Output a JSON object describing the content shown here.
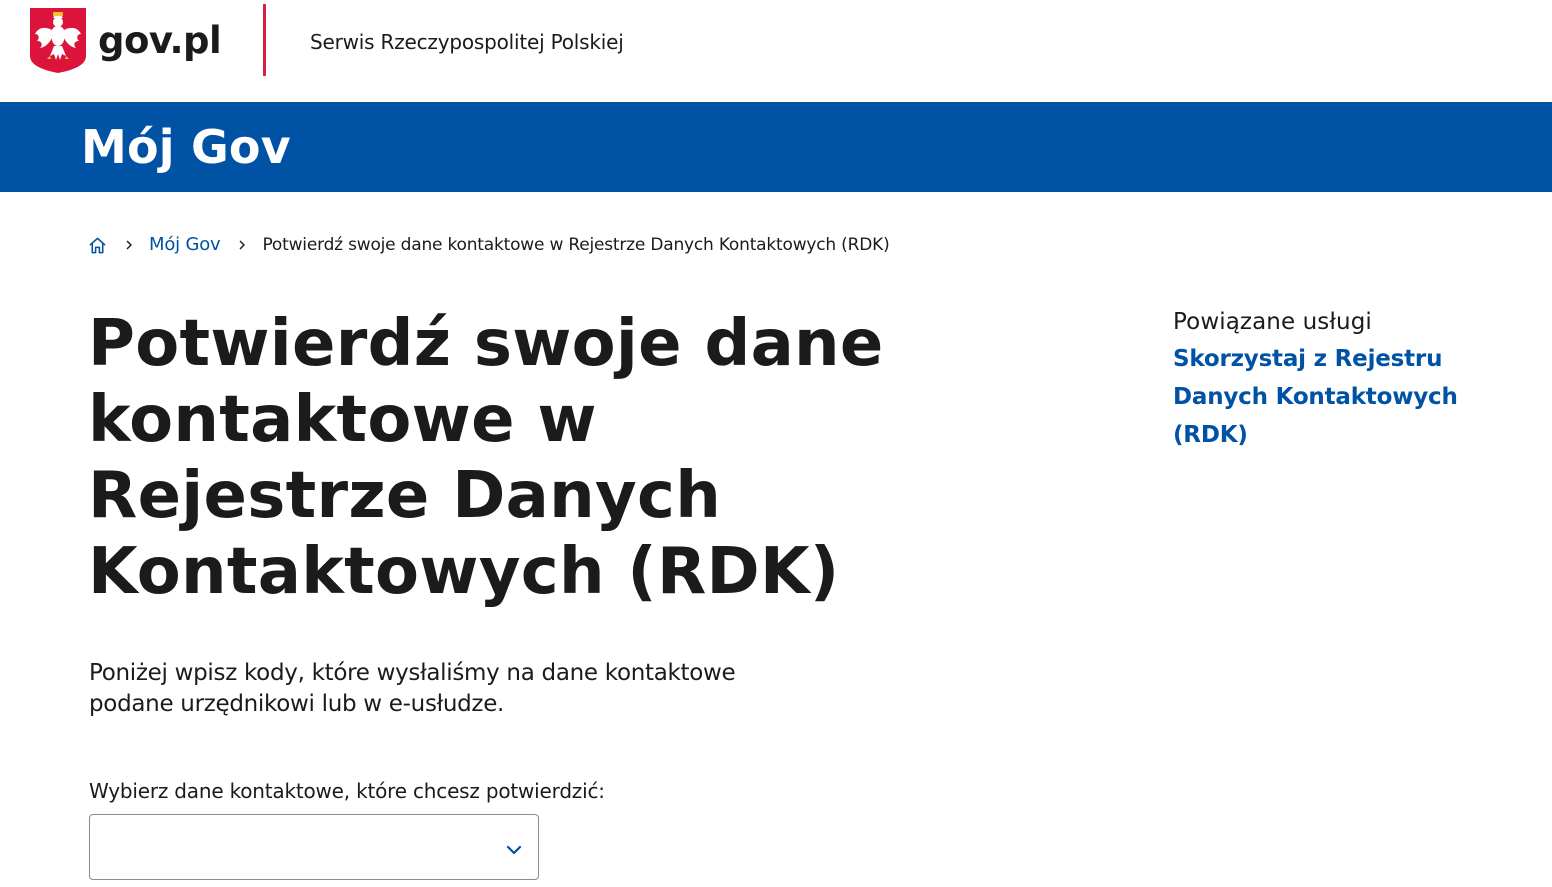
{
  "header": {
    "logo_text": "gov.pl",
    "service_name": "Serwis Rzeczypospolitej Polskiej",
    "emblem_icon": "polish-eagle-emblem",
    "accent_color": "#d4213d"
  },
  "band": {
    "title": "Mój Gov",
    "color": "#0052a5"
  },
  "breadcrumb": {
    "home_icon": "home-icon",
    "items": [
      {
        "label": "Mój Gov",
        "link": true
      },
      {
        "label": "Potwierdź swoje dane kontaktowe w Rejestrze Danych Kontaktowych (RDK)",
        "link": false
      }
    ]
  },
  "main": {
    "title": "Potwierdź swoje dane kontaktowe w Rejestrze Danych Kontaktowych (RDK)",
    "lead": "Poniżej wpisz kody, które wysłaliśmy na dane kontaktowe podane urzędnikowi lub w e-usłudze.",
    "select": {
      "label": "Wybierz dane kontaktowe, które chcesz potwierdzić:",
      "value": "",
      "icon": "chevron-down-icon"
    }
  },
  "sidebar": {
    "title": "Powiązane usługi",
    "links": [
      {
        "label": "Skorzystaj z Rejestru Danych Kontaktowych (RDK)"
      }
    ]
  }
}
